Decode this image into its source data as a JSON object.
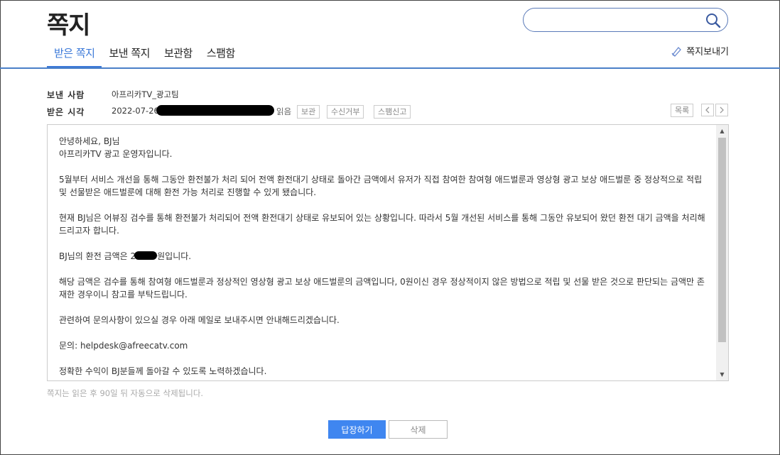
{
  "page": {
    "title": "쪽지"
  },
  "search": {
    "placeholder": ""
  },
  "tabs": [
    {
      "label": "받은 쪽지"
    },
    {
      "label": "보낸 쪽지"
    },
    {
      "label": "보관함"
    },
    {
      "label": "스팸함"
    }
  ],
  "compose": {
    "label": "쪽지보내기"
  },
  "message": {
    "sender_label": "보낸 사람",
    "sender": "아프리카TV_광고팀",
    "time_label": "받은 시각",
    "time": "2022-07-26",
    "read_status": "읽음",
    "actions": {
      "keep": "보관",
      "block": "수신거부",
      "spam": "스팸신고"
    },
    "list_label": "목록",
    "prev_icon": "chevron-left",
    "next_icon": "chevron-right",
    "body": {
      "p1_line1": "안녕하세요, BJ님",
      "p1_line2": "아프리카TV 광고 운영자입니다.",
      "p2": "5월부터 서비스 개선을 통해 그동안 환전불가 처리 되어 전액 환전대기 상태로 돌아간 금액에서 유저가 직접 참여한 참여형 애드벌룬과 영상형 광고 보상 애드벌룬 중 정상적으로 적립 및 선물받은 애드벌룬에 대해 환전 가능 처리로 진행할 수 있게 됐습니다.",
      "p3": "현재 BJ님은 어뷰징 검수를 통해 환전불가 처리되어 전액 환전대기 상태로 유보되어 있는 상황입니다. 따라서 5월 개선된 서비스를 통해 그동안 유보되어 왔던 환전 대기 금액을 처리해 드리고자 합니다.",
      "p4_prefix": "BJ님의 환전 금액은 2",
      "p4_suffix": "원입니다.",
      "p5": "해당 금액은 검수를 통해 참여형 애드벌룬과 정상적인 영상형 광고 보상 애드벌룬의 금액입니다, 0원이신 경우 정상적이지 않은 방법으로 적립 및 선물 받은 것으로 판단되는 금액만 존재한 경우이니 참고를 부탁드립니다.",
      "p6": "관련하여 문의사항이 있으실 경우 아래 메일로 보내주시면 안내해드리겠습니다.",
      "p7": "문의: helpdesk@afreecatv.com",
      "p8": "정확한 수익이 BJ분들께 돌아갈 수 있도록 노력하겠습니다."
    }
  },
  "notice": "쪽지는 읽은 후 90일 뒤 자동으로 삭제됩니다.",
  "buttons": {
    "reply": "답장하기",
    "delete": "삭제"
  },
  "colors": {
    "accent": "#3a78d8",
    "primary_button": "#3f86f0"
  }
}
